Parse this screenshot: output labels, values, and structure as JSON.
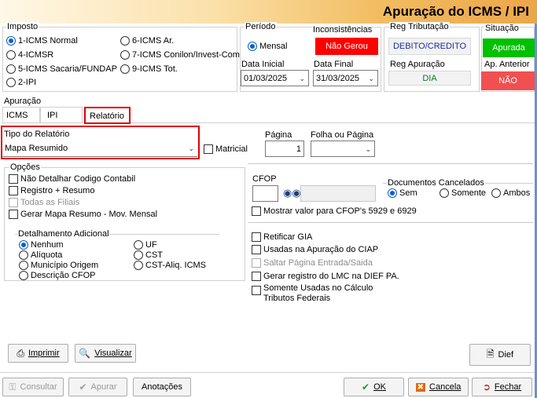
{
  "window": {
    "title": "Apuração do ICMS / IPI"
  },
  "imposto": {
    "title": "Imposto",
    "options": [
      "1-ICMS Normal",
      "4-ICMSR",
      "5-ICMS Sacaria/FUNDAP",
      "2-IPI",
      "6-ICMS Ar.",
      "7-ICMS Conilon/Invest-Com",
      "9-ICMS Tot."
    ],
    "selected": "1-ICMS Normal"
  },
  "periodo": {
    "title": "Período",
    "mensal_label": "Mensal",
    "data_inicial_label": "Data Inicial",
    "data_inicial": "01/03/2025",
    "data_final_label": "Data Final",
    "data_final": "31/03/2025"
  },
  "inconsistencias": {
    "title": "Inconsistências",
    "value": "Não Gerou",
    "color": "#ff0000"
  },
  "reg_tributacao": {
    "title": "Reg Tributação",
    "value": "DEBITO/CREDITO",
    "color": "#1a2e9e"
  },
  "reg_apuracao": {
    "title": "Reg Apuração",
    "value": "DIA",
    "color": "#0a7a28"
  },
  "situacao": {
    "title": "Situação",
    "value": "Apurada",
    "color": "#00c000"
  },
  "ap_anterior": {
    "title": "Ap. Anterior",
    "value": "NÃO",
    "color": "#f05050"
  },
  "apuracao": {
    "title": "Apuração",
    "tabs": [
      "ICMS",
      "IPI",
      "Relatório"
    ],
    "active_tab": "Relatório"
  },
  "relatorio": {
    "tipo_label": "Tipo do Relatório",
    "tipo_value": "Mapa Resumido",
    "matricial_label": "Matricial",
    "pagina_label": "Página",
    "pagina_value": "1",
    "folha_label": "Folha ou Página",
    "folha_value": ""
  },
  "opcoes": {
    "title": "Opções",
    "checks": [
      "Não Detalhar Codigo Contabil",
      "Registro + Resumo",
      "Todas as Filiais",
      "Gerar Mapa Resumo - Mov. Mensal"
    ]
  },
  "detalhamento": {
    "title": "Detalhamento Adicional",
    "options": [
      "Nenhum",
      "Alíquota",
      "Município Origem",
      "Descrição CFOP",
      "UF",
      "CST",
      "CST-Aliq. ICMS"
    ],
    "selected": "Nenhum"
  },
  "cfop": {
    "label": "CFOP",
    "value": "",
    "desc": ""
  },
  "documentos_cancelados": {
    "title": "Documentos Cancelados",
    "options": [
      "Sem",
      "Somente",
      "Ambos"
    ],
    "selected": "Sem"
  },
  "right_checks": {
    "mostrar_cfop": "Mostrar valor para CFOP's 5929 e 6929",
    "retificar_gia": "Retificar GIA",
    "usadas_ciap": "Usadas na Apuração do CIAP",
    "saltar_pagina": "Saltar Página Entrada/Saida",
    "gerar_lmc": "Gerar registro do LMC na DIEF PA.",
    "somente_usadas": "Somente Usadas no Cálculo\nTributos Federais"
  },
  "buttons": {
    "imprimir": "Imprimir",
    "visualizar": "Visualizar",
    "dief": "Dief",
    "consultar": "Consultar",
    "apurar": "Apurar",
    "anotacoes": "Anotações",
    "ok": "OK",
    "cancela": "Cancela",
    "fechar": "Fechar"
  }
}
